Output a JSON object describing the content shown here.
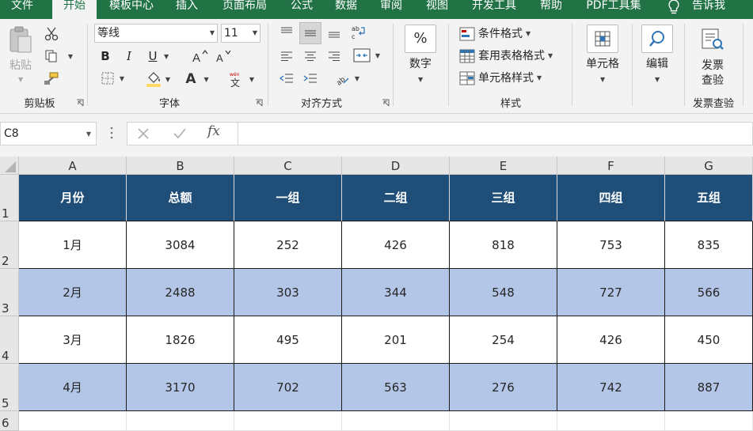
{
  "menu": {
    "tabs": [
      {
        "label": "文件",
        "active": false
      },
      {
        "label": "开始",
        "active": true
      },
      {
        "label": "模板中心",
        "active": false
      },
      {
        "label": "插入",
        "active": false
      },
      {
        "label": "页面布局",
        "active": false
      },
      {
        "label": "公式",
        "active": false
      },
      {
        "label": "数据",
        "active": false
      },
      {
        "label": "审阅",
        "active": false
      },
      {
        "label": "视图",
        "active": false
      },
      {
        "label": "开发工具",
        "active": false
      },
      {
        "label": "帮助",
        "active": false
      },
      {
        "label": "PDF工具集",
        "active": false
      }
    ],
    "tell_me": "告诉我"
  },
  "ribbon": {
    "groups": {
      "clipboard": "剪贴板",
      "font": "字体",
      "alignment": "对齐方式",
      "styles": "样式",
      "invoice_check": "发票查验"
    },
    "paste_label": "粘贴",
    "font_name": "等线",
    "font_size": "11",
    "bold": "B",
    "italic": "I",
    "underline": "U",
    "font_color_letter": "A",
    "number_label": "数字",
    "number_icon": "%",
    "conditional_format": "条件格式",
    "table_format": "套用表格格式",
    "cell_styles": "单元格样式",
    "cells_label": "单元格",
    "editing_label": "编辑",
    "invoice_label_1": "发票",
    "invoice_label_2": "查验",
    "icons": [
      "cut-icon",
      "copy-icon",
      "format-painter-icon",
      "borders-icon",
      "fill-color-icon",
      "phonetic-icon",
      "wrap-text-icon",
      "merge-icon",
      "orientation-icon",
      "search-icon"
    ]
  },
  "formula_bar": {
    "name_box": "C8",
    "fx": "fx",
    "formula": ""
  },
  "sheet": {
    "columns": [
      "A",
      "B",
      "C",
      "D",
      "E",
      "F",
      "G"
    ],
    "rows": [
      "1",
      "2",
      "3",
      "4",
      "5",
      "6"
    ],
    "header": [
      "月份",
      "总额",
      "一组",
      "二组",
      "三组",
      "四组",
      "五组"
    ],
    "data": [
      [
        "1月",
        "3084",
        "252",
        "426",
        "818",
        "753",
        "835"
      ],
      [
        "2月",
        "2488",
        "303",
        "344",
        "548",
        "727",
        "566"
      ],
      [
        "3月",
        "1826",
        "495",
        "201",
        "254",
        "426",
        "450"
      ],
      [
        "4月",
        "3170",
        "702",
        "563",
        "276",
        "742",
        "887"
      ]
    ],
    "colors": {
      "header_bg": "#1f4e78",
      "band_bg": "#b4c6e7",
      "ribbon_green": "#217346"
    }
  }
}
